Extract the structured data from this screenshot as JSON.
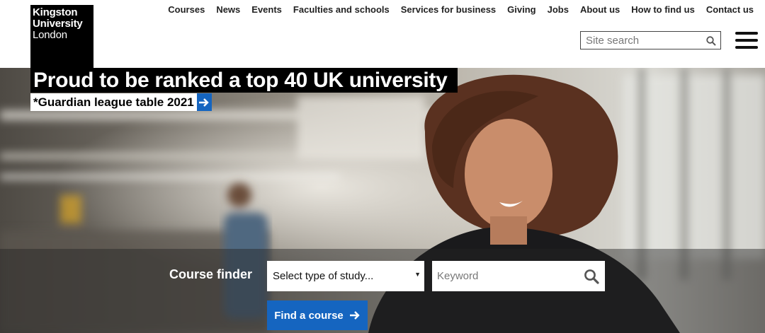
{
  "brand": {
    "line1": "Kingston",
    "line2": "University",
    "line3": "London"
  },
  "nav": {
    "items": [
      "Courses",
      "News",
      "Events",
      "Faculties and schools",
      "Services for business",
      "Giving",
      "Jobs",
      "About us",
      "How to find us",
      "Contact us"
    ]
  },
  "search": {
    "placeholder": "Site search",
    "icon": "magnifier-icon"
  },
  "menu": {
    "icon": "hamburger-icon"
  },
  "hero": {
    "headline": "Proud to be ranked a top 40 UK university",
    "subline": "*Guardian league table 2021",
    "subline_icon": "arrow-right-icon"
  },
  "finder": {
    "label": "Course finder",
    "select_value": "Select type of study...",
    "keyword_placeholder": "Keyword",
    "button_label": "Find a course",
    "button_icon": "arrow-right-icon"
  },
  "colors": {
    "accent": "#1565c0",
    "logo_bg": "#000000"
  }
}
